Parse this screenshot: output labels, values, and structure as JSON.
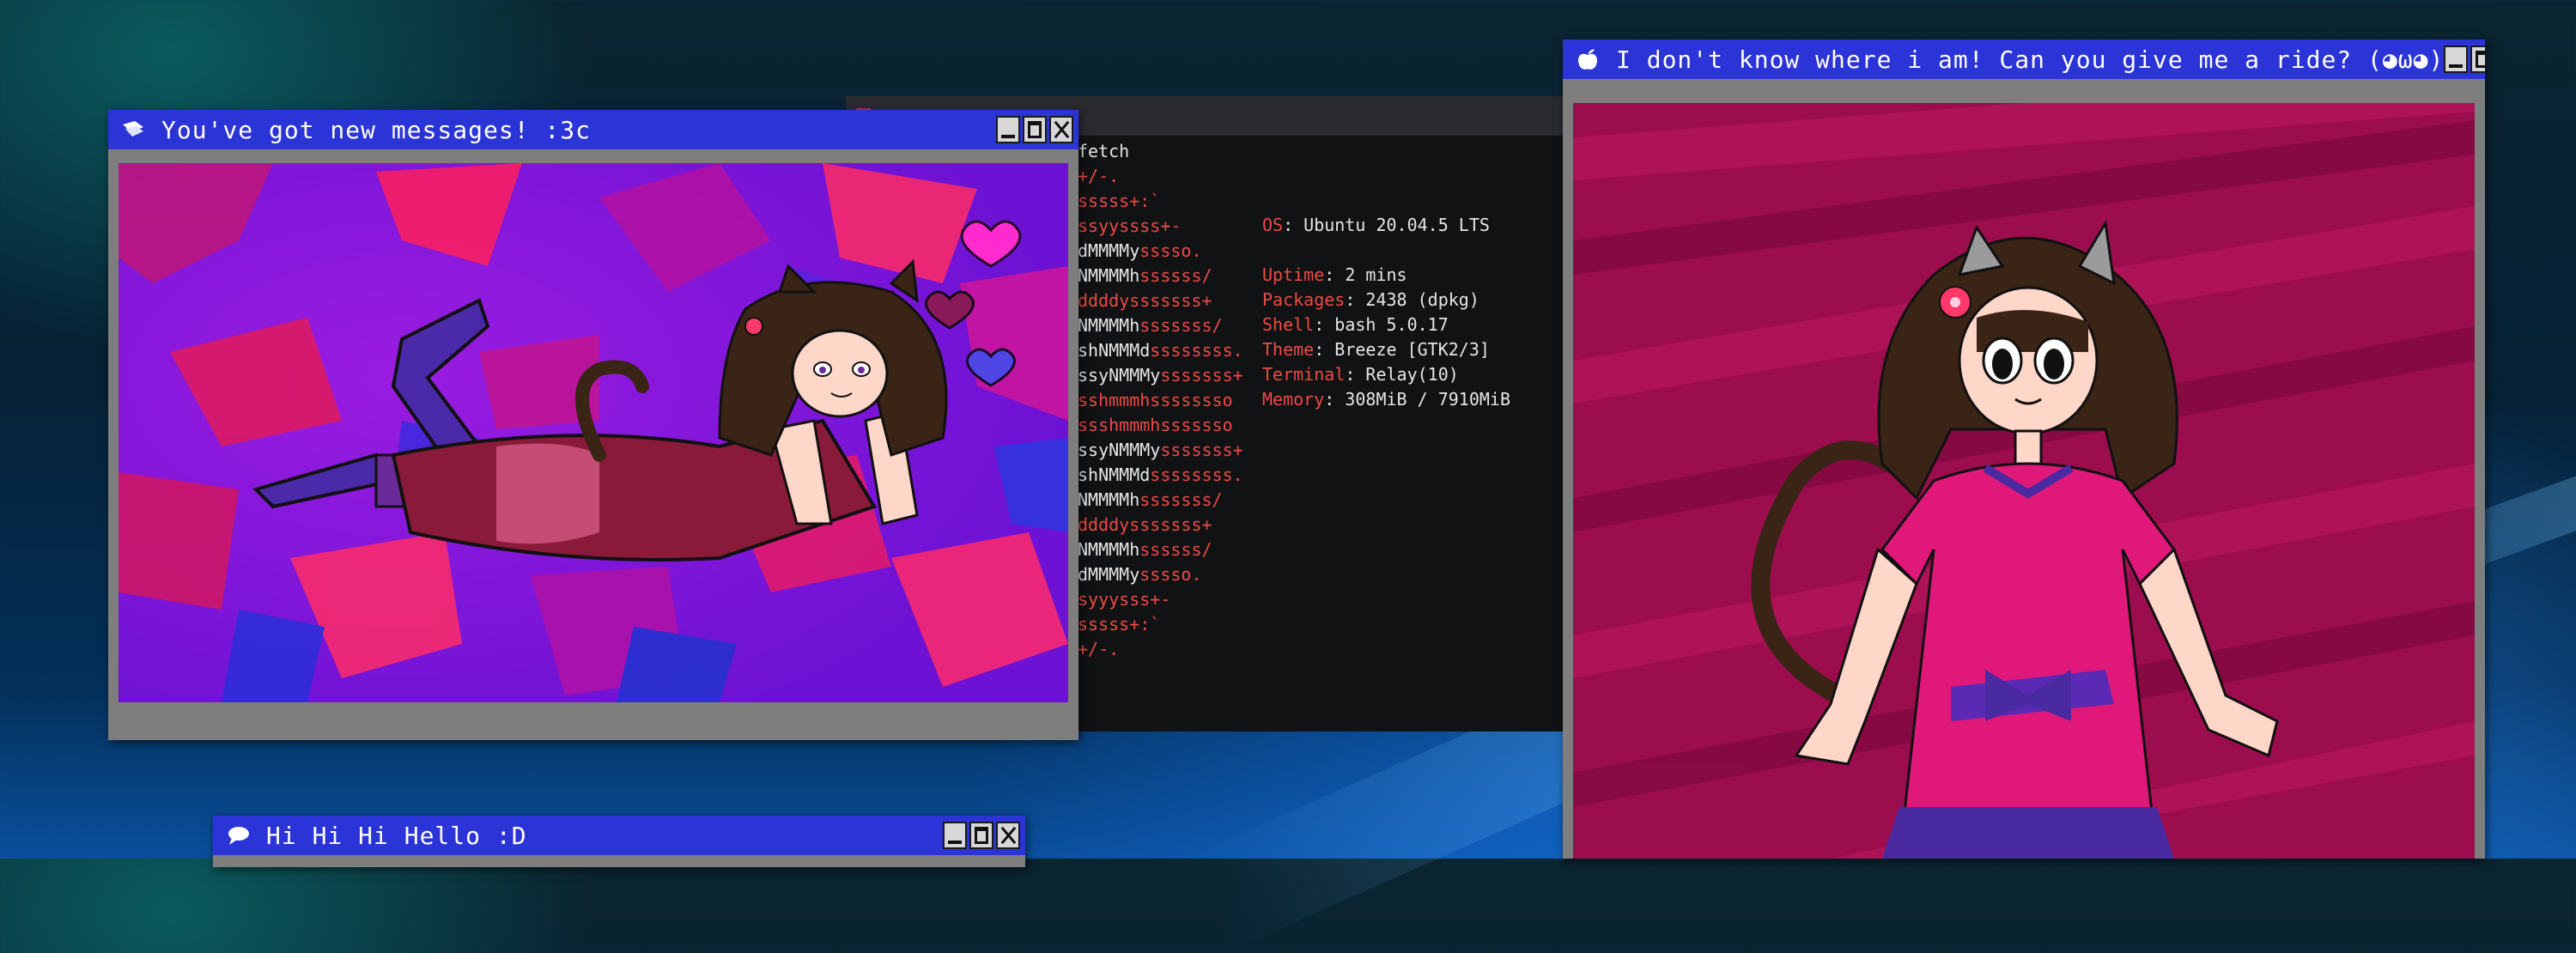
{
  "windows": {
    "messages": {
      "title": "You've got new messages! :3c",
      "icon": "envelope-icon",
      "image": "pixel art of a cat-eared girl lying on her stomach with hearts"
    },
    "ride": {
      "title": "I don't know where i am! Can you give me a ride? (◕ω◕)",
      "icon": "apple-icon",
      "image": "drawing of a cat-eared girl in a pink dress"
    },
    "hello": {
      "title": "Hi Hi Hi Hello :D",
      "icon": "speech-bubble-icon"
    }
  },
  "terminal": {
    "command": "fetch",
    "logo_lines": [
      "+/-.",
      "sssss+:`",
      "ssyyssss+-",
      "dMMMMysssso.",
      "NMMMMhssssss/",
      "ddddysssssss+",
      "NMMMMhsssssss/",
      "shNMMMdssssssss.",
      "ssyNMMMysssssss+",
      "sshmmmhssssssso",
      "ssshmmmhsssssso",
      "ssyNMMMysssssss+",
      "shNMMMdssssssss.",
      "NMMMMhsssssss/",
      "ddddysssssss+",
      "NMMMMhssssss/",
      "dMMMMysssso.",
      "syyysss+-",
      "sssss+:`",
      "+/-."
    ],
    "info": [
      {
        "key": "OS",
        "value": ": Ubuntu 20.04.5 LTS"
      },
      {
        "key": "",
        "value": ""
      },
      {
        "key": "Uptime",
        "value": ": 2 mins"
      },
      {
        "key": "Packages",
        "value": ": 2438 (dpkg)"
      },
      {
        "key": "Shell",
        "value": ": bash 5.0.17"
      },
      {
        "key": "Theme",
        "value": ": Breeze [GTK2/3]"
      },
      {
        "key": "Terminal",
        "value": ": Relay(10)"
      },
      {
        "key": "Memory",
        "value": ": 308MiB / 7910MiB"
      }
    ]
  },
  "colors": {
    "titlebar": "#2b34d6",
    "frame": "#7e7e7e",
    "terminal_red": "#ee4a45",
    "terminal_bg": "#111214"
  }
}
